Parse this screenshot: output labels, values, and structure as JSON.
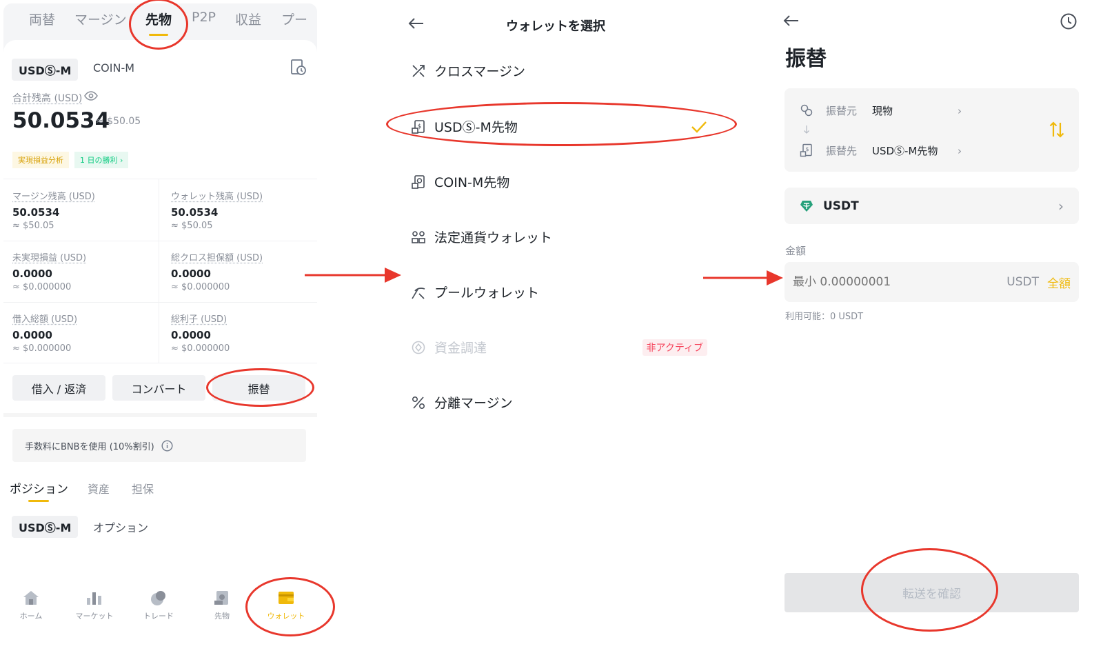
{
  "panel1": {
    "top_tabs": [
      "両替",
      "マージン",
      "先物",
      "P2P",
      "収益",
      "プー"
    ],
    "active_tab": "先物",
    "segments": {
      "active": "USDⓈ-M",
      "other": "COIN-M"
    },
    "total_balance_label": "合計残高 (USD)",
    "total_balance_value": "50.0534",
    "total_balance_approx": "≈ $50.05",
    "chip_pnl": "実現損益分析",
    "chip_win": "1 日の勝利",
    "grid": [
      {
        "label": "マージン残高 (USD)",
        "value": "50.0534",
        "approx": "≈ $50.05"
      },
      {
        "label": "ウォレット残高 (USD)",
        "value": "50.0534",
        "approx": "≈ $50.05"
      },
      {
        "label": "未実現損益 (USD)",
        "value": "0.0000",
        "approx": "≈ $0.000000"
      },
      {
        "label": "総クロス担保額 (USD)",
        "value": "0.0000",
        "approx": "≈ $0.000000"
      },
      {
        "label": "借入総額 (USD)",
        "value": "0.0000",
        "approx": "≈ $0.000000"
      },
      {
        "label": "総利子 (USD)",
        "value": "0.0000",
        "approx": "≈ $0.000000"
      }
    ],
    "buttons": {
      "borrow": "借入 / 返済",
      "convert": "コンバート",
      "transfer": "振替"
    },
    "bnb_note": "手数料にBNBを使用 (10%割引)",
    "position_tabs": [
      "ポジション",
      "資産",
      "担保"
    ],
    "position_segments": {
      "active": "USDⓈ-M",
      "other": "オプション"
    },
    "bottom_nav": [
      {
        "label": "ホーム",
        "icon": "home-icon"
      },
      {
        "label": "マーケット",
        "icon": "market-icon"
      },
      {
        "label": "トレード",
        "icon": "trade-icon"
      },
      {
        "label": "先物",
        "icon": "futures-icon"
      },
      {
        "label": "ウォレット",
        "icon": "wallet-icon"
      }
    ]
  },
  "panel2": {
    "title": "ウォレットを選択",
    "items": [
      {
        "label": "クロスマージン",
        "icon": "cross-margin-icon",
        "selected": false,
        "disabled": false
      },
      {
        "label": "USDⓈ-M先物",
        "icon": "futures-wallet-icon",
        "selected": true,
        "disabled": false
      },
      {
        "label": "COIN-M先物",
        "icon": "coin-futures-icon",
        "selected": false,
        "disabled": false
      },
      {
        "label": "法定通貨ウォレット",
        "icon": "fiat-wallet-icon",
        "selected": false,
        "disabled": false
      },
      {
        "label": "プールウォレット",
        "icon": "pool-wallet-icon",
        "selected": false,
        "disabled": false
      },
      {
        "label": "資金調達",
        "icon": "funding-icon",
        "selected": false,
        "disabled": true,
        "badge": "非アクティブ"
      },
      {
        "label": "分離マージン",
        "icon": "isolated-margin-icon",
        "selected": false,
        "disabled": false
      }
    ]
  },
  "panel3": {
    "title": "振替",
    "from_label": "振替元",
    "from_value": "現物",
    "to_label": "振替先",
    "to_value": "USDⓈ-M先物",
    "coin": "USDT",
    "amount_label": "金額",
    "amount_placeholder": "最小 0.00000001",
    "amount_unit": "USDT",
    "max_label": "全額",
    "available": "利用可能：0 USDT",
    "confirm": "転送を確認"
  },
  "colors": {
    "accent": "#f0b90b",
    "annotation_red": "#e8372c",
    "up_green": "#0ecb81",
    "inactive_red": "#f6465d",
    "tether_green": "#26a17b"
  }
}
